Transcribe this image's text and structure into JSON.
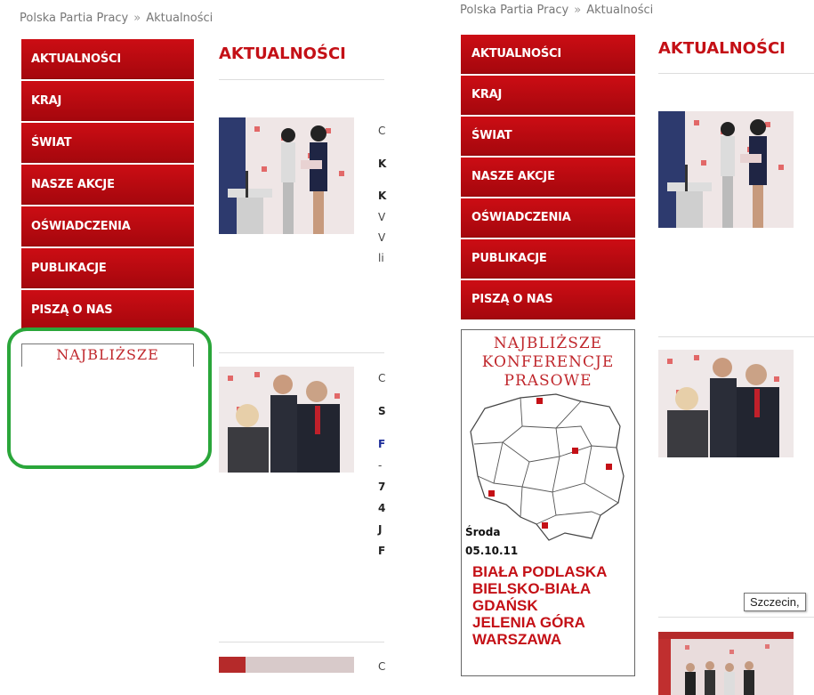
{
  "breadcrumb": {
    "home": "Polska Partia Pracy",
    "separator": "»",
    "current": "Aktualności"
  },
  "menu": [
    {
      "label": "AKTUALNOŚCI"
    },
    {
      "label": "KRAJ"
    },
    {
      "label": "ŚWIAT"
    },
    {
      "label": "NASZE AKCJE"
    },
    {
      "label": "OŚWIADCZENIA"
    },
    {
      "label": "PUBLIKACJE"
    },
    {
      "label": "PISZĄ O NAS"
    }
  ],
  "heading": "AKTUALNOŚCI",
  "banner": {
    "title_lines": [
      "NAJBLIŻSZE",
      "KONFERENCJE",
      "PRASOWE"
    ],
    "day": "Środa",
    "date": "05.10.11",
    "cities": [
      "BIAŁA PODLASKA",
      "BIELSKO-BIAŁA",
      "GDAŃSK",
      "JELENIA GÓRA",
      "WARSZAWA"
    ]
  },
  "left_snippets": {
    "a1": "C",
    "a2": "K",
    "a3": "K",
    "a4": "V",
    "a5": "V",
    "a6": "li",
    "b1": "C",
    "b2": "S",
    "b3": "F",
    "b4": "-",
    "b5": "7",
    "b6": "4",
    "b7": "J",
    "b8": "F",
    "c1": "C"
  },
  "tooltip": "Szczecin,",
  "colors": {
    "menu": "#b50a11",
    "heading": "#c41016",
    "highlight": "#2aa63a"
  }
}
